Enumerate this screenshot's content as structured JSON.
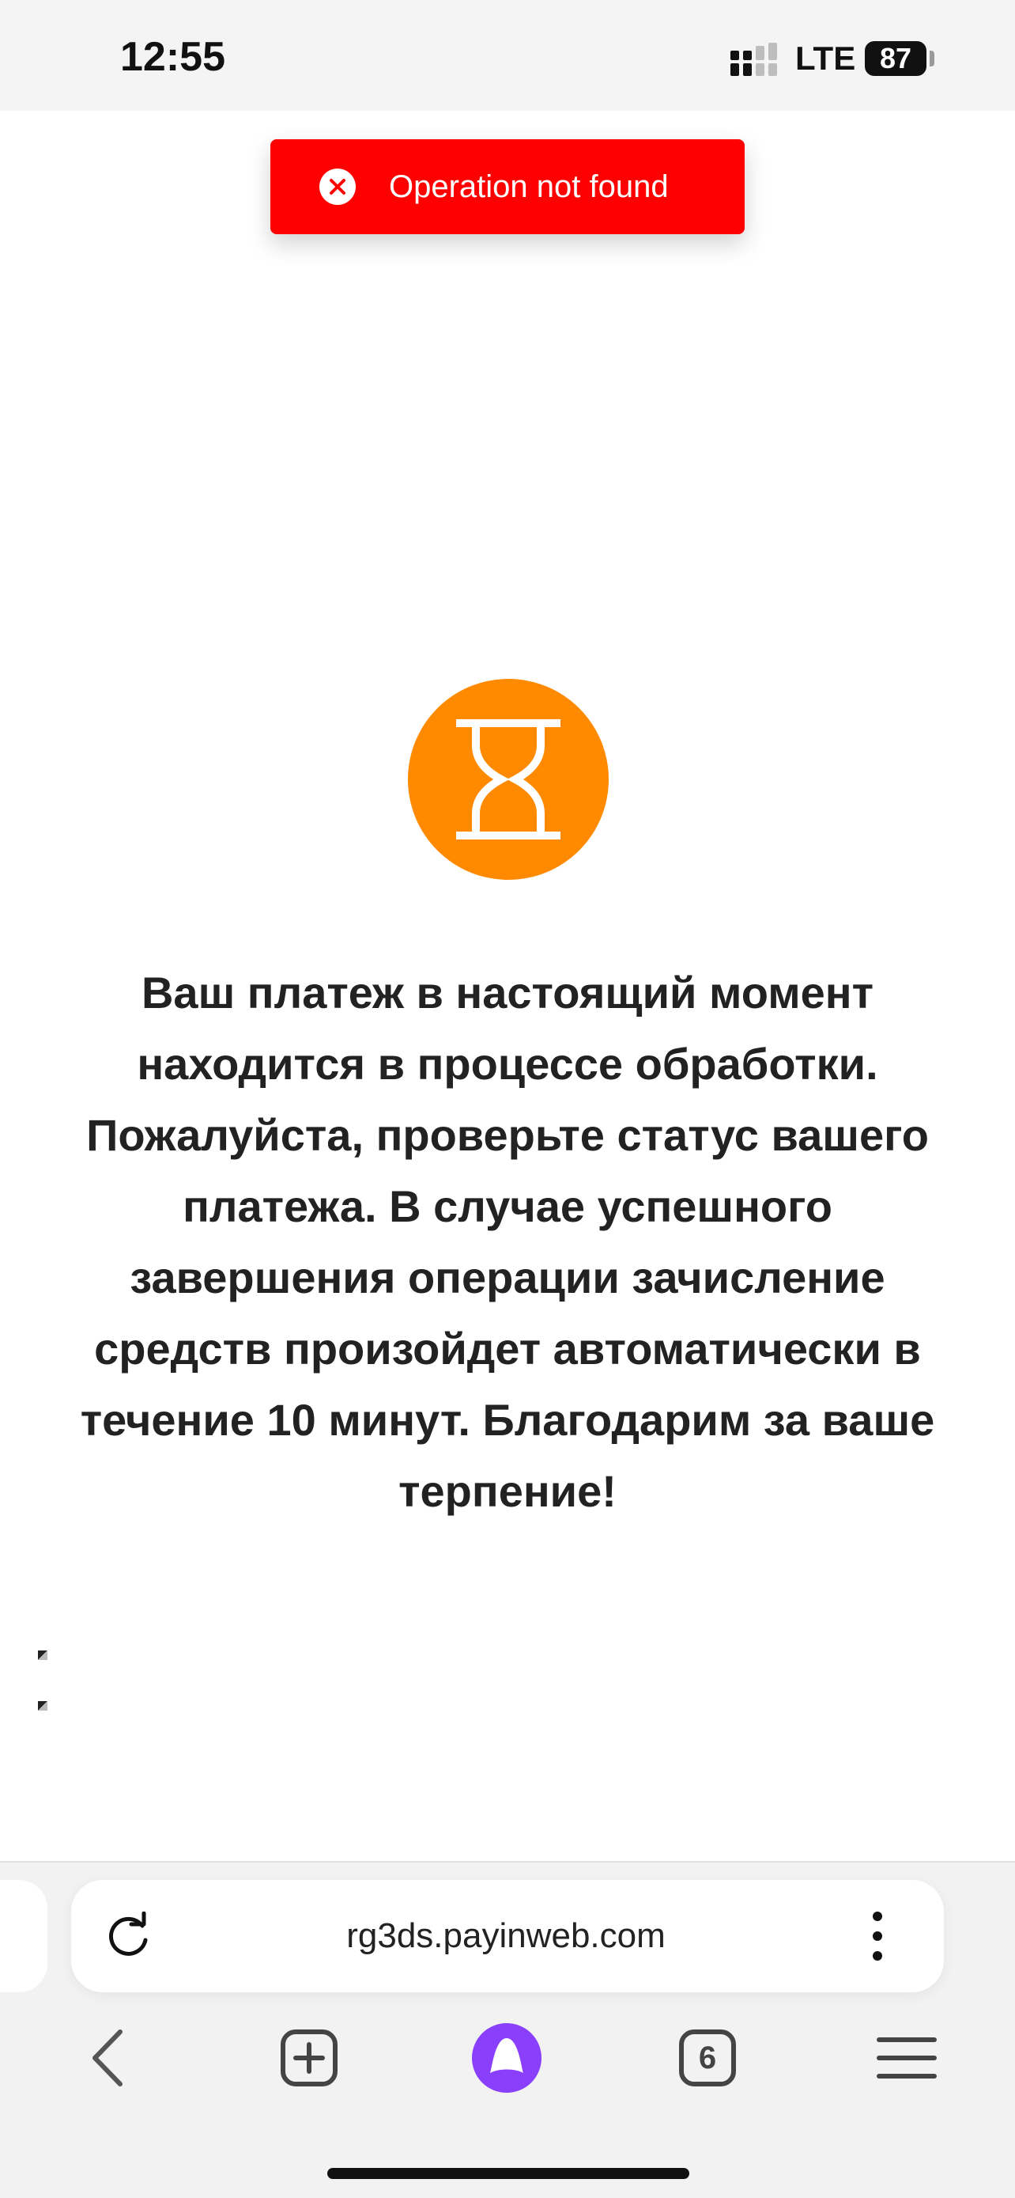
{
  "status_bar": {
    "time": "12:55",
    "network": "LTE",
    "battery": "87"
  },
  "toast": {
    "message": "Operation not found",
    "icon": "close-circle-icon",
    "color": "#ff0000"
  },
  "status": {
    "icon": "hourglass-icon",
    "color": "#ff8a00"
  },
  "message": {
    "text": "Ваш платеж в настоящий момент находится в процессе обработки. Пожалуйста, проверьте статус вашего платежа. В случае успешного завершения операции зачисление средств произойдет автоматически в течение 10 минут. Благодарим за ваше терпение!"
  },
  "browser": {
    "url": "rg3ds.payinweb.com",
    "tabs_count": "6",
    "assistant_color": "#8a3ffc"
  }
}
